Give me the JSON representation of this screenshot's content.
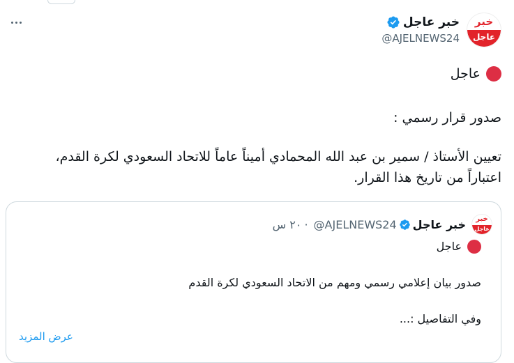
{
  "account": {
    "name": "خبر عاجل",
    "handle": "@AJELNEWS24",
    "avatar_top": "خبر",
    "avatar_bottom": "عاجل"
  },
  "tweet": {
    "breaking": "عاجل",
    "line1": "صدور قرار رسمي :",
    "line2": "تعيين الأستاذ / سمير بن عبد الله المحمادي أميناً عاماً للاتحاد السعودي لكرة القدم، اعتباراً من تاريخ هذا القرار."
  },
  "quoted": {
    "name": "خبر عاجل",
    "handle": "@AJELNEWS24",
    "dot": "·",
    "time": "٢٠ س",
    "avatar_top": "خبر",
    "avatar_bottom": "عاجل",
    "breaking": "عاجل",
    "line1": "صدور بيان إعلامي رسمي ومهم من الاتحاد السعودي لكرة القدم",
    "line2": "وفي التفاصيل :...",
    "show_more": "عرض المزيد"
  },
  "colors": {
    "brand_red": "#e2232a",
    "verified_blue": "#1d9bf0",
    "link_blue": "#1d9bf0"
  },
  "icons": [
    "more-icon",
    "verified-icon",
    "red-circle-emoji"
  ]
}
